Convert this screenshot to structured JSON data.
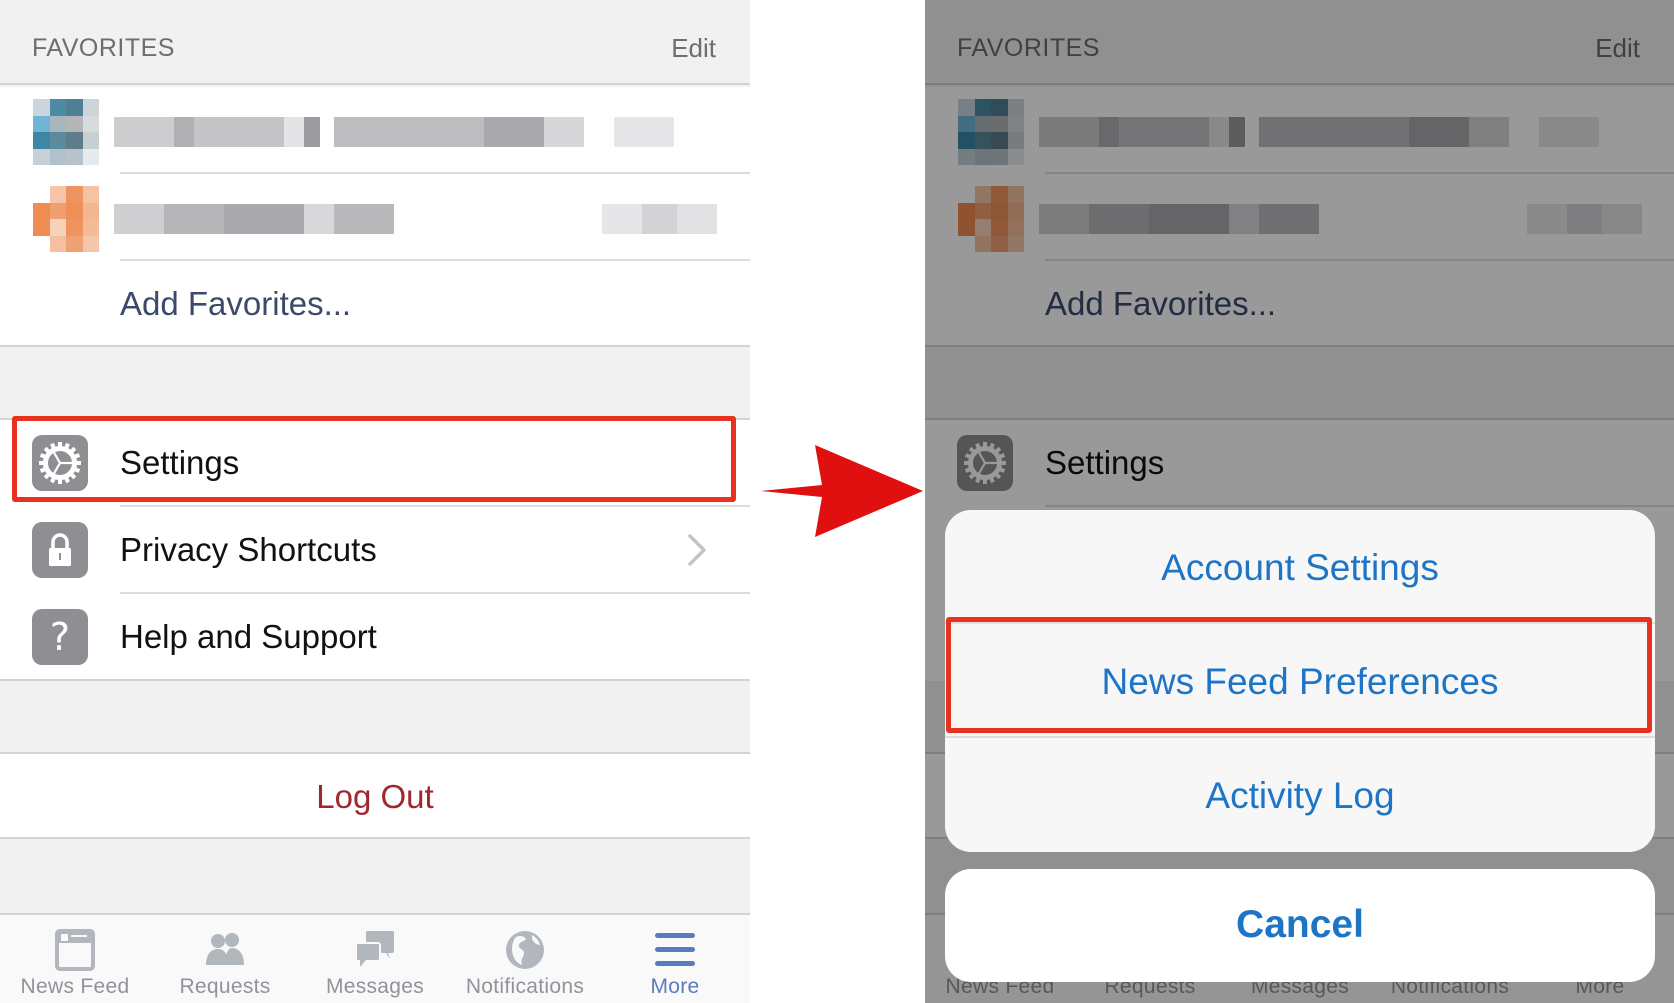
{
  "left_panel": {
    "header": {
      "title": "FAVORITES",
      "edit_label": "Edit"
    },
    "favorites": [
      {
        "name": "(pixelated name)",
        "avatar_palette": [
          "#c9d6de",
          "#4b8ba3",
          "#4f7f95",
          "#cdd5da",
          "#6fb5d6",
          "#a7b6bf",
          "#b3b5b8",
          "#d6dbde",
          "#3f85a5",
          "#5a8a9c",
          "#5e7c8b",
          "#c8cfd3",
          "#c5d0d7",
          "#b1c1cb",
          "#b7c3ca",
          "#e5eaed"
        ]
      },
      {
        "name": "(pixelated name)",
        "avatar_palette": [
          "#ffffff",
          "#f6c4a6",
          "#ee955f",
          "#f5c2a2",
          "#ef8b53",
          "#f09e6d",
          "#ee8f58",
          "#f5b590",
          "#ef8b53",
          "#f7d2bb",
          "#ef9460",
          "#f5bb99",
          "#ffffff",
          "#f4c0a1",
          "#f0a075",
          "#f5c6a9"
        ]
      }
    ],
    "add_favorites_label": "Add Favorites...",
    "menu": [
      {
        "label": "Settings",
        "icon": "gear-icon",
        "highlighted": true
      },
      {
        "label": "Privacy Shortcuts",
        "icon": "lock-icon",
        "has_chevron": true
      },
      {
        "label": "Help and Support",
        "icon": "question-icon"
      }
    ],
    "logout_label": "Log Out",
    "tabs": [
      {
        "label": "News Feed",
        "icon": "news-feed-icon"
      },
      {
        "label": "Requests",
        "icon": "friend-requests-icon"
      },
      {
        "label": "Messages",
        "icon": "messages-icon"
      },
      {
        "label": "Notifications",
        "icon": "globe-icon"
      },
      {
        "label": "More",
        "icon": "hamburger-menu-icon",
        "active": true
      }
    ]
  },
  "right_panel": {
    "header": {
      "title": "FAVORITES",
      "edit_label": "Edit"
    },
    "add_favorites_label": "Add Favorites...",
    "settings_label": "Settings",
    "action_sheet": {
      "items": [
        {
          "label": "Account Settings"
        },
        {
          "label": "News Feed Preferences",
          "highlighted": true
        },
        {
          "label": "Activity Log"
        }
      ],
      "cancel_label": "Cancel"
    },
    "tabs": [
      {
        "label": "News Feed"
      },
      {
        "label": "Requests"
      },
      {
        "label": "Messages"
      },
      {
        "label": "Notifications"
      },
      {
        "label": "More"
      }
    ]
  },
  "colors": {
    "highlight_box": "#e8321f",
    "arrow": "#e01010",
    "action_text": "#1f75c5",
    "logout_text": "#a2262d",
    "active_tab": "#5b7bc0",
    "link_text": "#3b4a6b"
  }
}
